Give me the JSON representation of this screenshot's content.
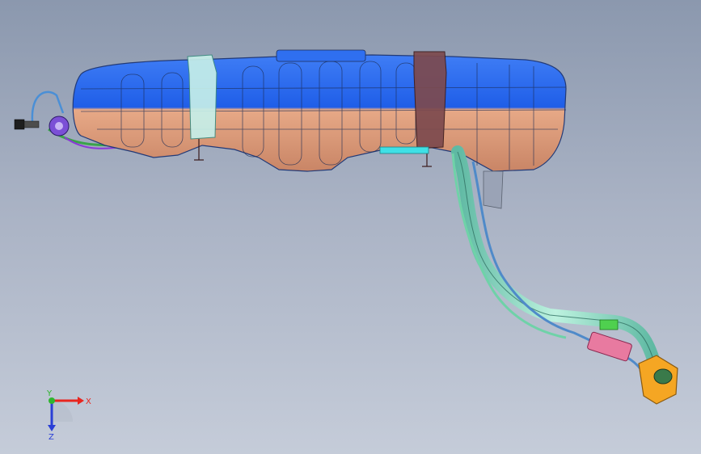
{
  "viewport": {
    "background_top": "#8b98ae",
    "background_bottom": "#c5ccd9"
  },
  "model": {
    "parts": [
      "fuel-tank",
      "tank-strap-front",
      "tank-strap-rear",
      "filler-neck-pipe",
      "vent-pipe",
      "filler-cap-flange",
      "canister-valve",
      "connector-bracket",
      "mount-studs"
    ],
    "colors": {
      "tank_top": "#1f5ee8",
      "tank_bottom": "#e7a987",
      "strap_front": "#bfe8e4",
      "strap_rear": "#7d4a4e",
      "pipe": "#8fdcc4",
      "pipe_edge": "#2f6f62",
      "flange": "#f5a623",
      "connector": "#e87aa0",
      "valve": "#7b4fd6"
    }
  },
  "triad": {
    "x_label": "X",
    "y_label": "Y",
    "z_label": "Z",
    "x_color": "#e8251f",
    "y_color": "#2fb52f",
    "z_color": "#2a3fd6"
  }
}
